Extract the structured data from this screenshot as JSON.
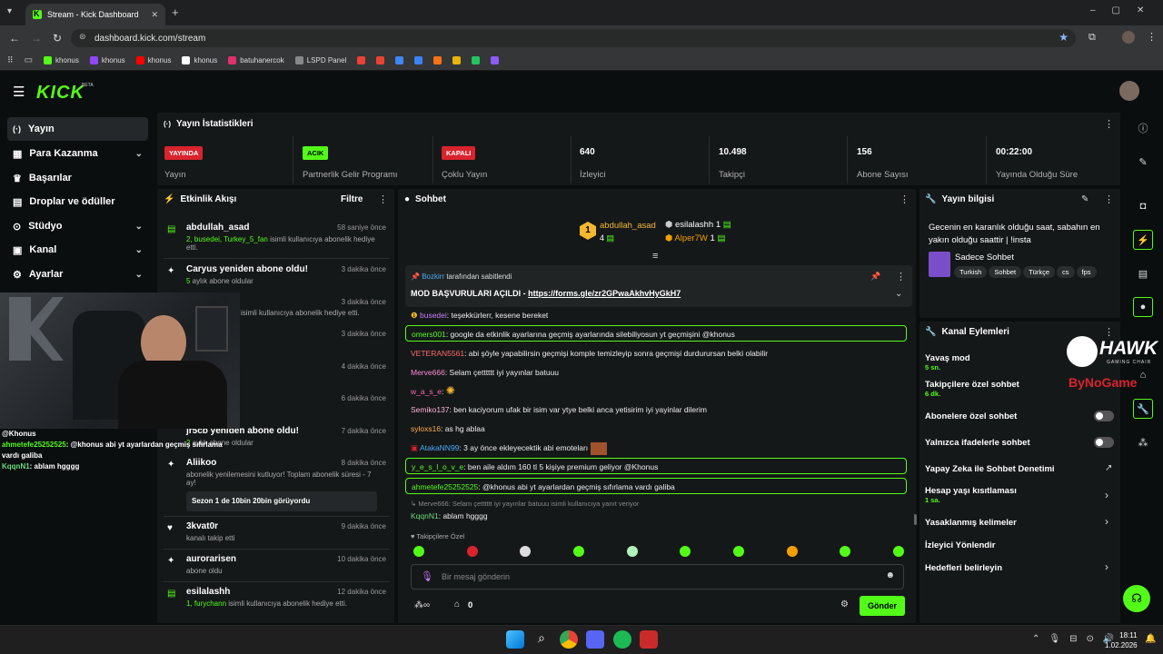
{
  "browser": {
    "tab_title": "Stream - Kick Dashboard",
    "url": "dashboard.kick.com/stream",
    "bookmarks": [
      {
        "label": "khonus",
        "color": "#53fc18"
      },
      {
        "label": "khonus",
        "color": "#9146ff"
      },
      {
        "label": "khonus",
        "color": "#ff0000"
      },
      {
        "label": "khonus",
        "color": "#ffffff"
      },
      {
        "label": "batuhanercok",
        "color": "#e1306c"
      },
      {
        "label": "LSPD Panel",
        "color": "#888888"
      }
    ]
  },
  "header": {
    "logo": "KICK",
    "beta": "BETA"
  },
  "sidebar": {
    "items": [
      {
        "label": "Yayın",
        "icon": "broadcast-icon",
        "glyph": "(·)"
      },
      {
        "label": "Para Kazanma",
        "icon": "money-icon",
        "glyph": "▦"
      },
      {
        "label": "Başarılar",
        "icon": "trophy-icon",
        "glyph": "♛"
      },
      {
        "label": "Droplar ve ödüller",
        "icon": "gift-icon",
        "glyph": "▤"
      },
      {
        "label": "Stüdyo",
        "icon": "studio-icon",
        "glyph": "⊙"
      },
      {
        "label": "Kanal",
        "icon": "channel-icon",
        "glyph": "▣"
      },
      {
        "label": "Ayarlar",
        "icon": "gear-icon",
        "glyph": "⚙"
      }
    ]
  },
  "stats": {
    "title": "Yayın İstatistikleri",
    "items": [
      {
        "badge": "YAYINDA",
        "label": "Yayın"
      },
      {
        "badge": "ACIK",
        "label": "Partnerlik Gelir Programı"
      },
      {
        "badge": "KAPALI",
        "label": "Çoklu Yayın"
      },
      {
        "value": "640",
        "label": "İzleyici"
      },
      {
        "value": "10.498",
        "label": "Takipçi"
      },
      {
        "value": "156",
        "label": "Abone Sayısı"
      },
      {
        "value": "00:22:00",
        "label": "Yayında Olduğu Süre"
      }
    ],
    "colors": {
      "live": "#d9232d",
      "on": "#53fc18"
    }
  },
  "activity": {
    "title": "Etkinlik Akışı",
    "filter": "Filtre",
    "items": [
      {
        "title": "abdullah_asad",
        "detail_g": "2, busedei, Turkey_5_fan",
        "detail": " isimli kullanıcıya abonelik hediye etti.",
        "time": "58 saniye önce"
      },
      {
        "title": "Caryus yeniden abone oldu!",
        "detail_g": "5",
        "detail": " aylık abone oldular",
        "time": "3 dakika önce"
      },
      {
        "title": "",
        "detail_g": "",
        "detail": "isimli kullanıcıya abonelik hediye etti.",
        "time": "3 dakika önce"
      },
      {
        "title": "",
        "detail_g": "",
        "detail": "",
        "time": "3 dakika önce"
      },
      {
        "title": "",
        "detail_g": "",
        "detail": "",
        "time": "4 dakika önce"
      },
      {
        "title": "",
        "detail_g": "",
        "detail": "",
        "time": "6 dakika önce"
      },
      {
        "title": "jr5cb yeniden abone oldu!",
        "detail_g": "2",
        "detail": " aylık abone oldular",
        "time": "7 dakika önce"
      },
      {
        "title": "Aliikoo",
        "detail_g": "",
        "detail": "abonelik yenilemesini kutluyor! Toplam abonelik süresi - 7 ay!",
        "time": "8 dakika önce",
        "note": "Sezon 1 de 10bin 20bin görüyordu"
      },
      {
        "title": "3kvat0r",
        "detail_g": "",
        "detail": "kanalı takip etti",
        "time": "9 dakika önce"
      },
      {
        "title": "aurorarisen",
        "detail_g": "",
        "detail": "abone oldu",
        "time": "10 dakika önce"
      },
      {
        "title": "esilalashh",
        "detail_g": "1, furychann",
        "detail": " isimli kullanıcıya abonelik hediye etti.",
        "time": "12 dakika önce"
      }
    ]
  },
  "overlay_chat": [
    {
      "user": "",
      "text": "@Khonus"
    },
    {
      "user": "ahmetefe25252525",
      "text": ": @khonus abi yt ayarlardan geçmiş sıfırlama vardı galiba"
    },
    {
      "user": "KqqnN1",
      "text": ": ablam hgggg"
    }
  ],
  "chat": {
    "title": "Sohbet",
    "leaders": [
      {
        "name": "abdullah_asad",
        "count": "4",
        "rank": "1"
      },
      {
        "name": "esilalashh",
        "count": "1"
      },
      {
        "name": "Alper7W",
        "count": "1"
      }
    ],
    "pinned": {
      "by": "Bozkirr",
      "by_suffix": " tarafından sabitlendi",
      "text": "MOD BAŞVURULARI AÇILDI - ",
      "link": "https://forms.gle/zr2GPwaAkhvHyGkH7"
    },
    "messages": [
      {
        "user": "busedei",
        "color": "#c77dff",
        "text": ": teşekkürlerr, kesene bereket"
      },
      {
        "user": "omers001",
        "color": "#53fc18",
        "text": ": google da etkinlik ayarlarına geçmiş ayarlarında silebiliyosun yt geçmişini @khonus",
        "hl": true
      },
      {
        "user": "VETERAN5561",
        "color": "#ff6b6b",
        "text": ": abi şöyle yapabilirsin geçmişi komple temizleyip sonra geçmişi durdurursan belki olabilir"
      },
      {
        "user": "Merve666",
        "color": "#ff8ad8",
        "text": ": Selam çetttttt iyi yayınlar batuuu"
      },
      {
        "user": "w_a_s_e",
        "color": "#ff6bb5",
        "text": ":"
      },
      {
        "user": "Semiko137",
        "color": "#ffb3d9",
        "text": ": ben kaciyorum ufak bir isim var ytye belki anca yetisirim iyi yayinlar dilerim"
      },
      {
        "user": "syloxs16",
        "color": "#ffa94d",
        "text": ": as hg ablaa"
      },
      {
        "user": "AtakaNN99",
        "color": "#4dabf7",
        "text": ": 3 ay önce ekleyecektik abi emoteları"
      },
      {
        "user": "y_e_s_l_o_v_e",
        "color": "#53fc18",
        "text": ": ben aile aldım 160 tl 5 kişiye premium geliyor @Khonus",
        "hl": true
      },
      {
        "user": "ahmetefe25252525",
        "color": "#53fc18",
        "text": ": @khonus abi yt ayarlardan geçmiş sıfırlama vardı galiba",
        "hl": true
      },
      {
        "user": "KqqnN1",
        "color": "#69db7c",
        "text": ": ablam hgggg"
      }
    ],
    "reply_hint": "Merve666: Selam çetttttt iyi yayınlar batuuu isimli kullanıcıya yanıt veriyor",
    "followers_only": "Takipçilere Özel",
    "input_placeholder": "Bir mesaj gönderin",
    "points": "0",
    "send": "Gönder"
  },
  "stream_info": {
    "title": "Yayın bilgisi",
    "stream_title": "Gecenin en karanlık olduğu saat, sabahın en yakın olduğu saattir | !insta",
    "category": "Sadece Sohbet",
    "tags": [
      "Turkish",
      "Sohbet",
      "Türkçe",
      "cs",
      "fps"
    ]
  },
  "channel_actions": {
    "title": "Kanal Eylemleri",
    "items": [
      {
        "label": "Yavaş mod",
        "sub": "5 sn."
      },
      {
        "label": "Takipçilere özel sohbet",
        "sub": "6 dk."
      },
      {
        "label": "Abonelere özel sohbet"
      },
      {
        "label": "Yalnızca ifadelerle sohbet"
      },
      {
        "label": "Yapay Zeka ile Sohbet Denetimi"
      },
      {
        "label": "Hesap yaşı kısıtlaması",
        "sub": "1 sa."
      },
      {
        "label": "Yasaklanmış kelimeler"
      },
      {
        "label": "İzleyici Yönlendir"
      },
      {
        "label": "Hedefleri belirleyin"
      }
    ]
  },
  "sponsor": {
    "brand": "HAWK",
    "sub": "GAMING CHAIR",
    "partner": "ByNoGame"
  },
  "taskbar": {
    "time": "18:11",
    "date": "1.02.2026"
  }
}
